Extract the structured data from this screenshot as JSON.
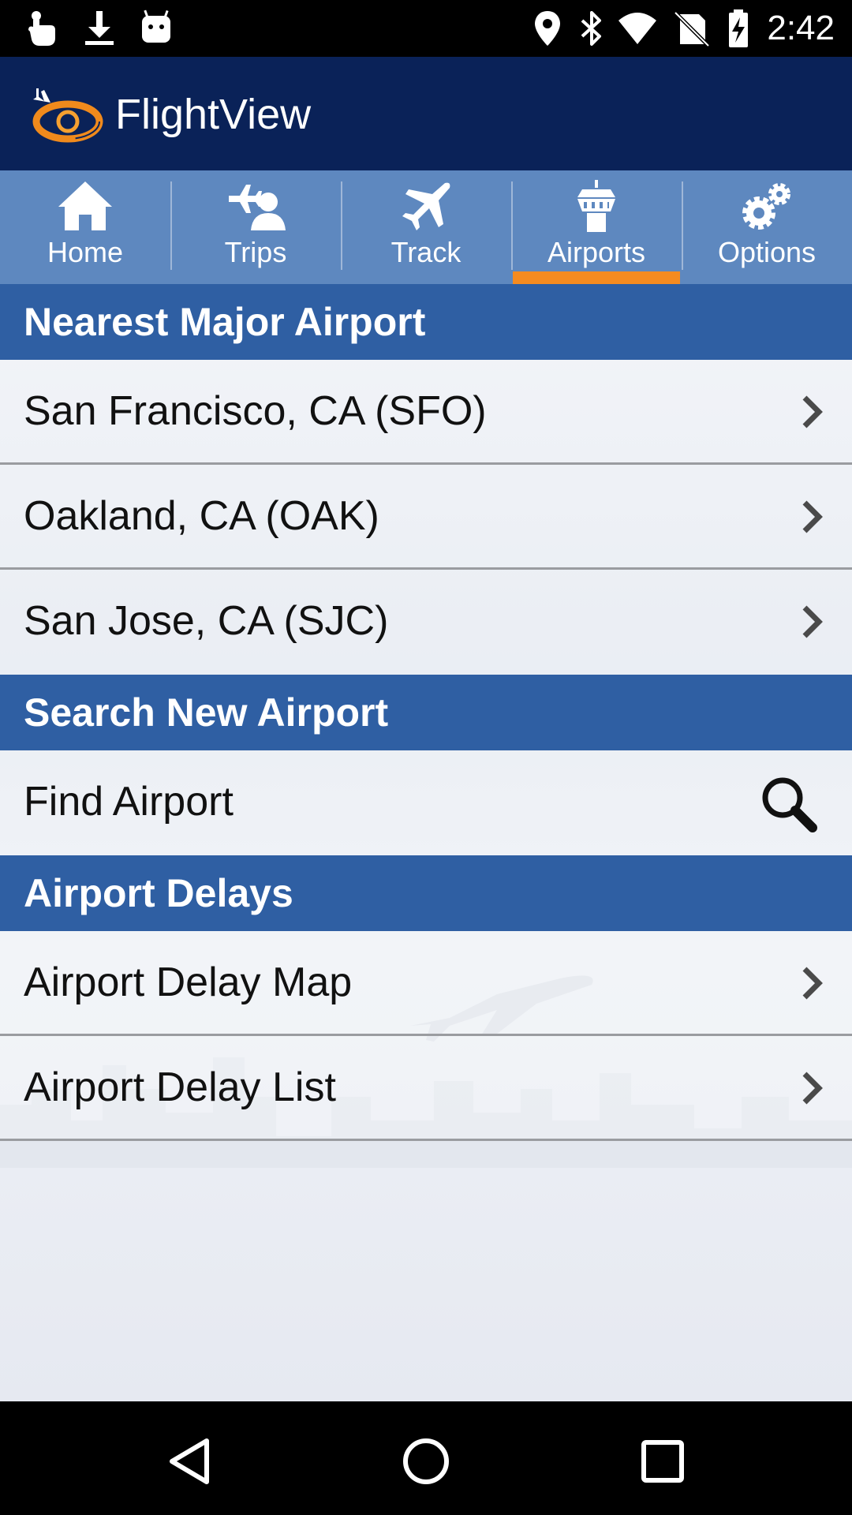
{
  "status_bar": {
    "time": "2:42",
    "left_icons": [
      "touch-icon",
      "download-icon",
      "android-icon"
    ],
    "right_icons": [
      "location-icon",
      "bluetooth-icon",
      "wifi-icon",
      "no-sim-icon",
      "battery-charging-icon"
    ]
  },
  "app_bar": {
    "title": "FlightView"
  },
  "tabs": [
    {
      "label": "Home",
      "icon": "home-icon",
      "active": false
    },
    {
      "label": "Trips",
      "icon": "trips-icon",
      "active": false
    },
    {
      "label": "Track",
      "icon": "plane-icon",
      "active": false
    },
    {
      "label": "Airports",
      "icon": "control-tower-icon",
      "active": true
    },
    {
      "label": "Options",
      "icon": "gears-icon",
      "active": false
    }
  ],
  "sections": {
    "nearest": {
      "title": "Nearest Major Airport",
      "items": [
        "San Francisco, CA (SFO)",
        "Oakland, CA (OAK)",
        "San Jose, CA (SJC)"
      ]
    },
    "search": {
      "title": "Search New Airport",
      "item": "Find Airport"
    },
    "delays": {
      "title": "Airport Delays",
      "items": [
        "Airport Delay Map",
        "Airport Delay List"
      ]
    }
  },
  "colors": {
    "app_bar": "#0a2258",
    "tab_bar": "#5e88bf",
    "active_tab_indicator": "#f58b20",
    "section_header": "#2f5fa3"
  }
}
